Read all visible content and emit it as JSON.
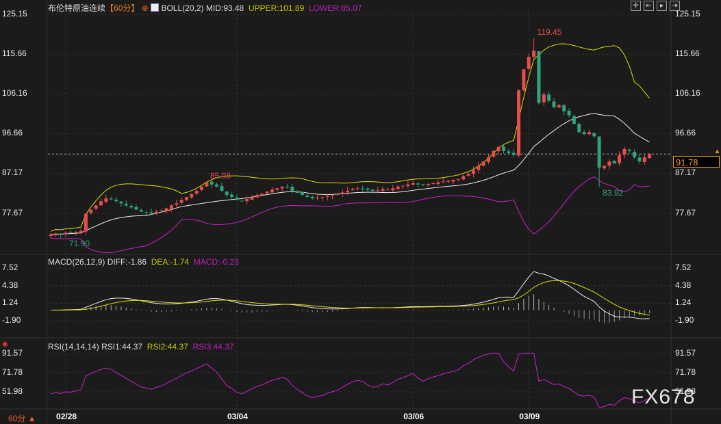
{
  "header": {
    "title": "布伦特原油连续",
    "period": "【60分】",
    "indicator": "BOLL(20,2)",
    "mid": "MID:93.48",
    "upper": "UPPER:101.89",
    "lower": "LOWER:85.07",
    "tools": [
      "crosshair-icon",
      "zoom-range-icon",
      "play-icon",
      "move-right-icon"
    ]
  },
  "macd_header": {
    "name": "MACD(26,12,9)",
    "diff": "DIFF:-1.86",
    "dea": "DEA:-1.74",
    "macd": "MACD:-0.23"
  },
  "rsi_header": {
    "name": "RSI(14,14,14)",
    "rsi1": "RSI1:44.37",
    "rsi2": "RSI2:44.37",
    "rsi3": "RSI3:44.37"
  },
  "footer": {
    "period_label": "60分 ▲"
  },
  "watermark": "FX678",
  "last_price": "91.78",
  "colors": {
    "up": "#e84d4d",
    "down": "#2fa37a",
    "mid": "#f0f0f0",
    "upper": "#e0e000",
    "lower": "#d020d0",
    "accent": "#f08020"
  },
  "chart_data": [
    {
      "type": "candlestick",
      "title": "布伦特原油连续",
      "y_ticks": [
        "125.15",
        "115.66",
        "106.16",
        "96.66",
        "87.17",
        "77.67"
      ],
      "ylim": [
        69.5,
        125.15
      ],
      "x_ticks": [
        {
          "label": "02/28",
          "index": 3
        },
        {
          "label": "03/04",
          "index": 37
        },
        {
          "label": "03/06",
          "index": 72
        },
        {
          "label": "03/09",
          "index": 95
        }
      ],
      "closes": [
        72.5,
        72.8,
        72.6,
        73,
        72.9,
        73.2,
        73.4,
        77.5,
        78.5,
        79.5,
        80.5,
        81.2,
        81,
        80.5,
        80,
        79.5,
        79,
        78.5,
        78,
        77.8,
        77.6,
        78,
        78.3,
        78.8,
        79.5,
        80,
        80.8,
        81.5,
        82.2,
        83,
        84,
        85,
        84.5,
        84,
        83,
        82,
        81.5,
        80.8,
        80.5,
        81,
        81.5,
        82,
        82.3,
        82.8,
        83.3,
        83.6,
        84,
        83.8,
        83,
        82.5,
        82,
        81.5,
        81.2,
        81.4,
        81.5,
        81.8,
        82,
        82.2,
        82.6,
        83,
        83.4,
        83.6,
        83.5,
        83.2,
        83,
        83.1,
        83.4,
        83.3,
        83.6,
        84,
        84.2,
        84.5,
        84.8,
        84.5,
        84.3,
        84.6,
        84.8,
        85,
        85.2,
        85.4,
        85.6,
        85.8,
        86.5,
        87,
        88,
        89,
        90,
        91,
        92.5,
        93.5,
        92.5,
        92,
        91.5,
        107,
        112,
        115,
        116.5,
        104,
        106,
        104.5,
        103,
        103.5,
        102,
        101,
        99,
        97,
        96.5,
        97,
        96,
        88.5,
        89,
        90,
        89.5,
        91.5,
        93,
        92.5,
        91,
        90,
        91,
        91.78
      ],
      "annotations": [
        {
          "label": "119.45",
          "index": 96,
          "type": "high"
        },
        {
          "label": "85.08",
          "index": 31,
          "type": "high"
        },
        {
          "label": "71.90",
          "index": 3,
          "type": "low"
        },
        {
          "label": "83.92",
          "index": 109,
          "type": "low"
        }
      ]
    },
    {
      "type": "line",
      "title": "MACD(26,12,9)",
      "y_ticks": [
        "7.52",
        "4.38",
        "1.24",
        "-1.90"
      ]
    },
    {
      "type": "line",
      "title": "RSI(14,14,14)",
      "y_ticks": [
        "91.57",
        "71.78",
        "51.98"
      ]
    }
  ]
}
